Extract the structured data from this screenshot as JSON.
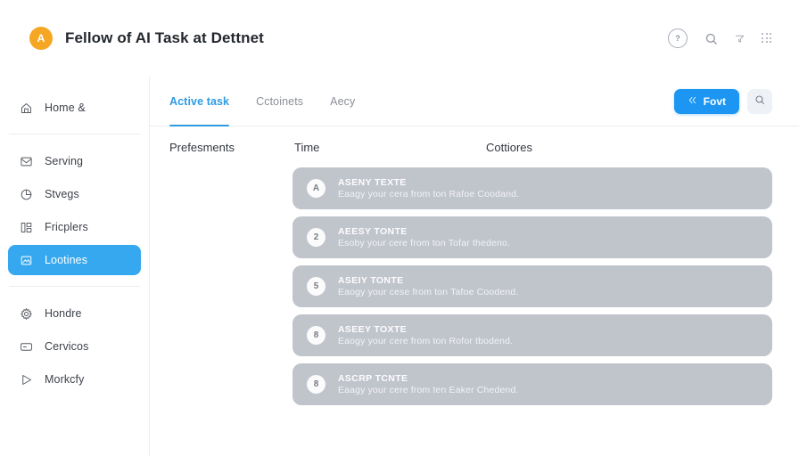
{
  "header": {
    "avatar_initial": "A",
    "title": "Fellow of AI Task at Dettnet",
    "actions": [
      {
        "name": "help-icon",
        "glyph": "?"
      },
      {
        "name": "search-icon",
        "glyph": ""
      },
      {
        "name": "filter-icon",
        "glyph": ""
      },
      {
        "name": "apps-grid-icon",
        "glyph": ""
      }
    ]
  },
  "sidebar": {
    "items": [
      {
        "label": "Home &",
        "icon": "home-icon",
        "active": false
      },
      {
        "label": "Serving",
        "icon": "mail-icon",
        "active": false
      },
      {
        "label": "Stvegs",
        "icon": "pie-chart-icon",
        "active": false
      },
      {
        "label": "Fricplers",
        "icon": "grid-icon",
        "active": false
      },
      {
        "label": "Lootines",
        "icon": "image-icon",
        "active": true
      },
      {
        "label": "Hondre",
        "icon": "gear-icon",
        "active": false
      },
      {
        "label": "Cervicos",
        "icon": "card-icon",
        "active": false
      },
      {
        "label": "Morkcfy",
        "icon": "play-icon",
        "active": false
      }
    ]
  },
  "main": {
    "tabs": [
      {
        "label": "Active task",
        "active": true
      },
      {
        "label": "Cctoinets",
        "active": false
      },
      {
        "label": "Aecy",
        "active": false
      }
    ],
    "primary_button": "Fovt",
    "search_button_icon": "search-icon",
    "columns": {
      "c1": "Prefesments",
      "c2": "Time",
      "c3": "Cottiores"
    },
    "tasks": [
      {
        "badge": "A",
        "title": "ASENY TEXTE",
        "subtitle": "Eaagy your cera from ton Rafoe Coodand."
      },
      {
        "badge": "2",
        "title": "AEESY TONTE",
        "subtitle": "Esoby your cere from ton Tofar thedeno."
      },
      {
        "badge": "5",
        "title": "ASEIY TONTE",
        "subtitle": "Eaogy your cese from ton Tafoe Coodend."
      },
      {
        "badge": "8",
        "title": "ASEEY TOXTE",
        "subtitle": "Eaogy your cere from ton Rofor tbodend."
      },
      {
        "badge": "8",
        "title": "ASCRP TCNTE",
        "subtitle": "Eaagy your cere from ten Eaker Chedend."
      }
    ]
  },
  "colors": {
    "accent": "#1c96f2",
    "sidebar_active": "#36a8ef",
    "brand": "#f5a623",
    "card": "#c0c4cb"
  }
}
